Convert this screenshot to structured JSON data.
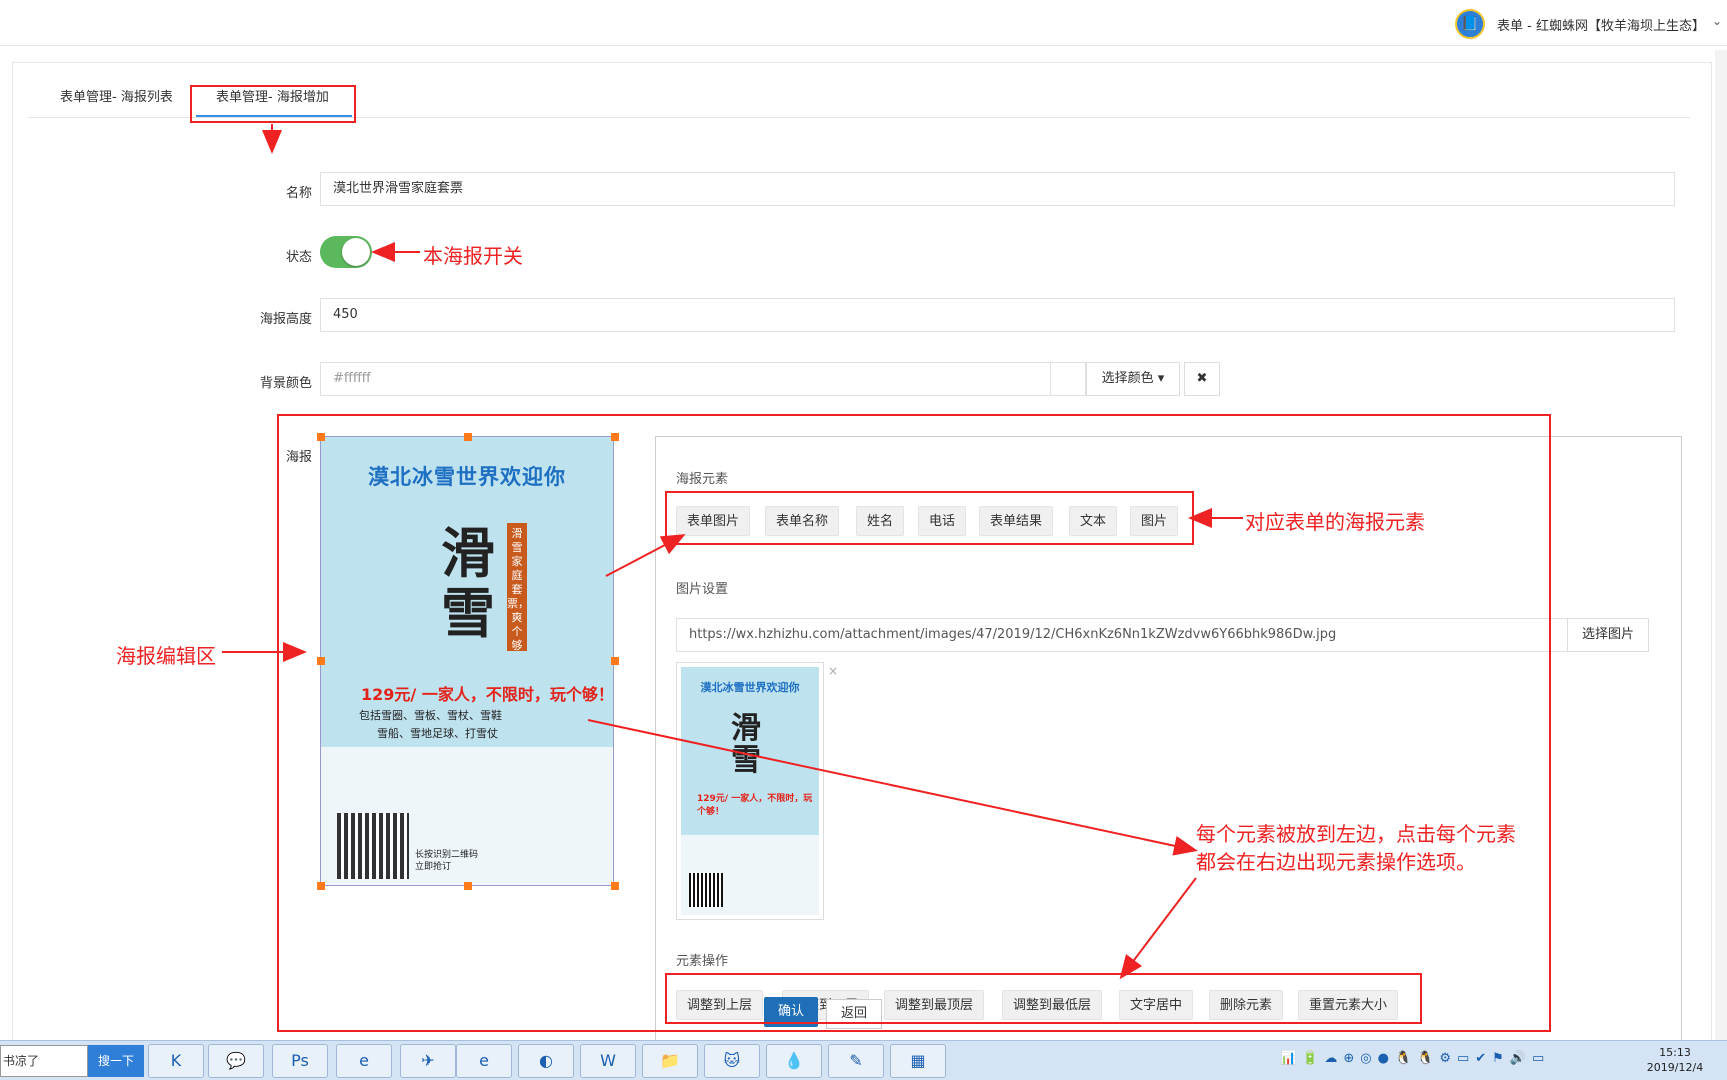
{
  "window": {
    "title": "表单 - 红蜘蛛网【牧羊海坝上生态】",
    "caret": "⌄",
    "logo_icon": "📘"
  },
  "tabs": [
    {
      "label": "表单管理- 海报列表",
      "active": false
    },
    {
      "label": "表单管理- 海报增加",
      "active": true
    }
  ],
  "form": {
    "name_label": "名称",
    "name_value": "漠北世界滑雪家庭套票",
    "status_label": "状态",
    "status_on": true,
    "height_label": "海报高度",
    "height_value": "450",
    "bgcolor_label": "背景颜色",
    "bgcolor_placeholder": "#ffffff",
    "choose_color_label": "选择颜色 ▾",
    "clear_label": "✖",
    "poster_label": "海报"
  },
  "poster": {
    "title": "漠北冰雪世界欢迎你",
    "big_text": "滑\n雪",
    "vertical_text": "滑雪家庭套票，爽个够",
    "price_text": "129元/ 一家人，不限时，玩个够！",
    "include_line1": "包括雪圈、雪板、雪杖、雪鞋",
    "include_line2": "雪船、雪地足球、打雪仗",
    "qr_text": "长按识别二维码\n立即抢订"
  },
  "right": {
    "elements_title": "海报元素",
    "elements": [
      "表单图片",
      "表单名称",
      "姓名",
      "电话",
      "表单结果",
      "文本",
      "图片"
    ],
    "image_settings_title": "图片设置",
    "image_url": "https://wx.hzhizhu.com/attachment/images/47/2019/12/CH6xnKz6Nn1kZWzdvw6Y66bhk986Dw.jpg",
    "choose_image_label": "选择图片",
    "thumb_title": "漠北冰雪世界欢迎你",
    "thumb_big": "滑\n雪",
    "thumb_price": "129元/ 一家人，不限时，玩个够！",
    "thumb_close": "×",
    "ops_title": "元素操作",
    "ops": [
      "调整到上层",
      "调整到下层",
      "调整到最顶层",
      "调整到最低层",
      "文字居中",
      "删除元素",
      "重置元素大小"
    ],
    "dialog_ok": "确认",
    "dialog_back": "返回"
  },
  "annotations": {
    "switch_note": "本海报开关",
    "elements_note": "对应表单的海报元素",
    "edit_area_note": "海报编辑区",
    "explain_line1": "每个元素被放到左边，点击每个元素",
    "explain_line2": "都会在右边出现元素操作选项。",
    "accent_color": "#ee2222"
  },
  "taskbar": {
    "search_text": "书凉了",
    "search_button": "搜一下",
    "apps": [
      "K",
      "💬",
      "Ps",
      "e",
      "✈",
      "e",
      "◐",
      "W",
      "📁",
      "🐱",
      "💧",
      "✎",
      "▦"
    ],
    "time": "15:13",
    "date": "2019/12/4",
    "tray": "📊🔋☁⊕◎●🐧🐧⚙▭✔⚑🔊▭"
  }
}
